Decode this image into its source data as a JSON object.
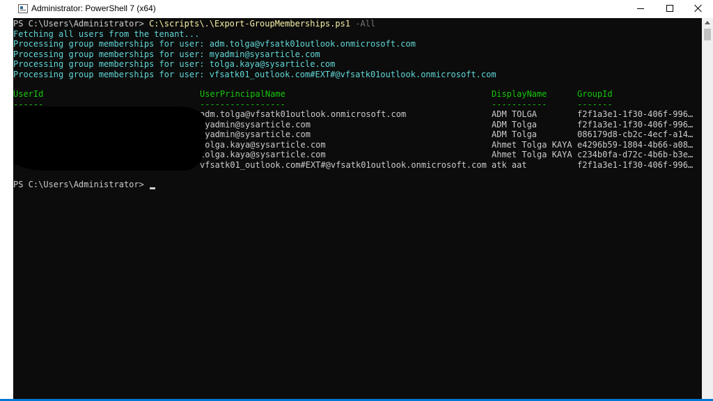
{
  "window": {
    "title": "Administrator: PowerShell 7 (x64)"
  },
  "console": {
    "prompt": "PS C:\\Users\\Administrator> ",
    "command": "C:\\scripts\\.\\Export-GroupMemberships.ps1",
    "command_param": " -All",
    "messages": [
      "Fetching all users from the tenant...",
      "Processing group memberships for user: adm.tolga@vfsatk01outlook.onmicrosoft.com",
      "Processing group memberships for user: myadmin@sysarticle.com",
      "Processing group memberships for user: tolga.kaya@sysarticle.com",
      "Processing group memberships for user: vfsatk01_outlook.com#EXT#@vfsatk01outlook.onmicrosoft.com"
    ],
    "table": {
      "headers": [
        "UserId",
        "UserPrincipalName",
        "DisplayName",
        "GroupId"
      ],
      "underlines": [
        "------",
        "-----------------",
        "-----------",
        "-------"
      ],
      "rows": [
        {
          "upn": "adm.tolga@vfsatk01outlook.onmicrosoft.com",
          "display": "ADM TOLGA",
          "group": "f2f1a3e1-1f30-406f-996…"
        },
        {
          "upn": "myadmin@sysarticle.com",
          "display": "ADM Tolga",
          "group": "f2f1a3e1-1f30-406f-996…"
        },
        {
          "upn": "myadmin@sysarticle.com",
          "display": "ADM Tolga",
          "group": "086179d8-cb2c-4ecf-a14…"
        },
        {
          "upn": "tolga.kaya@sysarticle.com",
          "display": "Ahmet Tolga KAYA",
          "group": "e4296b59-1804-4b66-a08…"
        },
        {
          "upn": "tolga.kaya@sysarticle.com",
          "display": "Ahmet Tolga KAYA",
          "group": "c234b0fa-d72c-4b6b-b3e…"
        },
        {
          "upn": "vfsatk01_outlook.com#EXT#@vfsatk01outlook.onmicrosoft.com",
          "display": "atk aat",
          "group": "f2f1a3e1-1f30-406f-996…"
        }
      ]
    },
    "final_prompt": "PS C:\\Users\\Administrator> "
  },
  "colors": {
    "background": "#0c0c0c",
    "text": "#cccccc",
    "command": "#f9f1a5",
    "parameter": "#767676",
    "message": "#61d6d6",
    "header": "#16c60c"
  }
}
